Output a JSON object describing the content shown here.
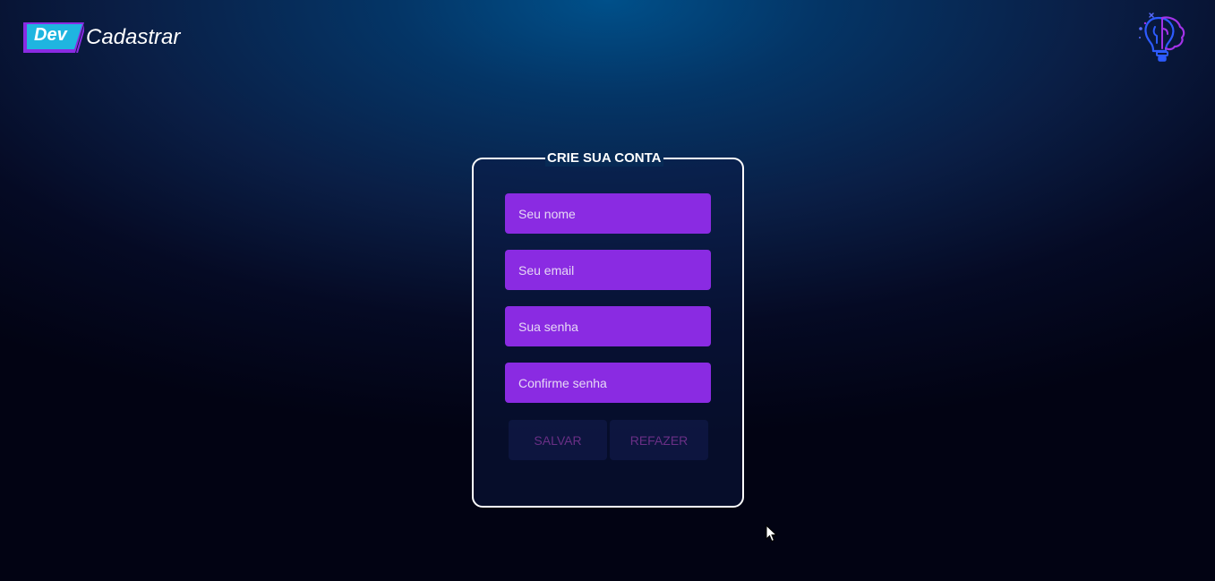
{
  "brand": {
    "badge_text": "Dev",
    "word": "Cadastrar"
  },
  "form": {
    "legend": "CRIE SUA CONTA",
    "fields": [
      {
        "placeholder": "Seu nome"
      },
      {
        "placeholder": "Seu email"
      },
      {
        "placeholder": "Sua senha"
      },
      {
        "placeholder": "Confirme senha"
      }
    ],
    "save_label": "SALVAR",
    "reset_label": "REFAZER"
  },
  "icons": {
    "logo": "dev-badge-icon",
    "top_right": "lightbulb-brain-icon",
    "cursor": "mouse-pointer-icon"
  },
  "colors": {
    "field_bg": "#8a2be2",
    "badge_cyan": "#1fb5e0",
    "badge_purple": "#8a2be2",
    "button_text": "#6a2f86"
  }
}
